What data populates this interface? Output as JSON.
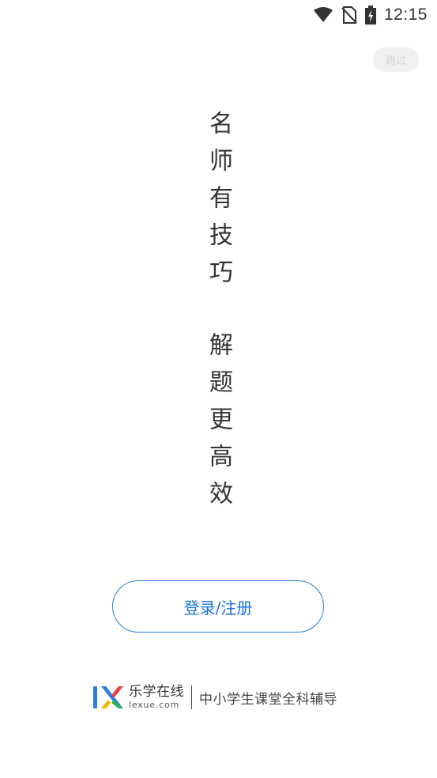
{
  "status_bar": {
    "time": "12:15",
    "icons": [
      "wifi-icon",
      "no-sim-icon",
      "battery-charging-icon"
    ]
  },
  "skip_button": {
    "label": "跳过"
  },
  "slogan": {
    "line1": "名师有技巧",
    "line2": "解题更高效"
  },
  "login_button": {
    "label": "登录/注册"
  },
  "footer": {
    "brand_name": "乐学在线",
    "brand_domain": "lexue.com",
    "tagline": "中小学生课堂全科辅导",
    "logo_colors": [
      "#2f7be5",
      "#e8433f",
      "#f5b400",
      "#2cb45a"
    ]
  }
}
